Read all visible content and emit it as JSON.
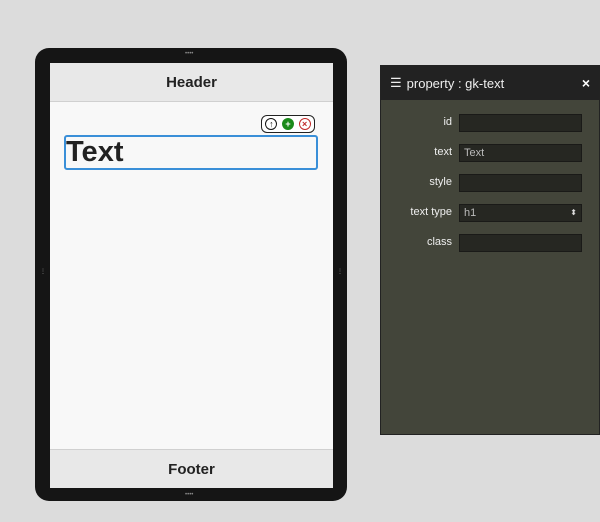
{
  "device": {
    "header": "Header",
    "footer": "Footer",
    "text": "Text",
    "toolbar": {
      "icons": [
        "arrow-up-icon",
        "plus-icon",
        "close-icon"
      ],
      "colors": [
        "#111111",
        "#1a8a1a",
        "#c02828"
      ]
    }
  },
  "panel": {
    "title": "property : gk-text",
    "close": "×",
    "fields": [
      {
        "label": "id",
        "value": ""
      },
      {
        "label": "text",
        "value": "Text"
      },
      {
        "label": "style",
        "value": ""
      },
      {
        "label": "text type",
        "value": "h1"
      },
      {
        "label": "class",
        "value": ""
      }
    ]
  }
}
